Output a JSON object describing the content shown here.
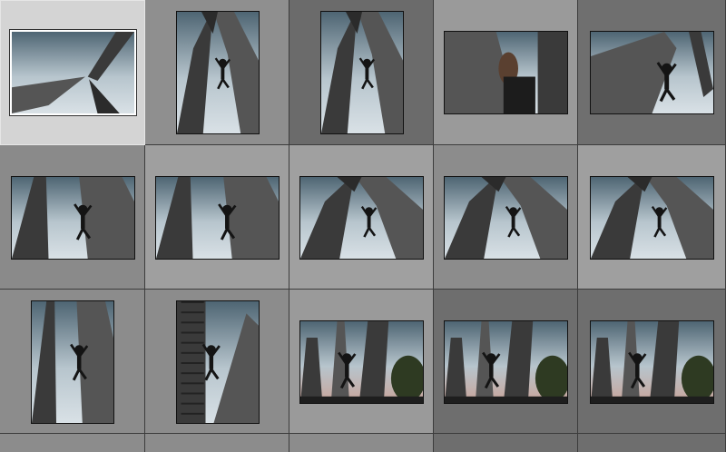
{
  "app": {
    "view": "grid",
    "accent_selected": "#d6d6d6",
    "cell_light": "#a3a3a3",
    "cell_mid": "#8c8c8c",
    "cell_dark": "#6b6b6b"
  },
  "thumbnails": [
    {
      "name": "monument-arms-up",
      "icon": "photo-icon",
      "orient": "landscape",
      "scene": "upward-arms",
      "selected": true
    },
    {
      "name": "climber-between-pillars",
      "icon": "photo-icon",
      "orient": "portrait",
      "scene": "arch-climber"
    },
    {
      "name": "climber-arch-high",
      "icon": "photo-icon",
      "orient": "portrait",
      "scene": "arch-climber"
    },
    {
      "name": "climber-closeup-wall",
      "icon": "photo-icon",
      "orient": "landscape",
      "scene": "closeup"
    },
    {
      "name": "climber-crouch-side",
      "icon": "photo-icon",
      "orient": "landscape",
      "scene": "side-climber"
    },
    {
      "name": "climber-left-column",
      "icon": "photo-icon",
      "orient": "landscape",
      "scene": "wall-climber"
    },
    {
      "name": "climber-mid-column",
      "icon": "photo-icon",
      "orient": "landscape",
      "scene": "wall-climber"
    },
    {
      "name": "climber-under-arch-a",
      "icon": "photo-icon",
      "orient": "landscape",
      "scene": "arch-climber"
    },
    {
      "name": "climber-under-arch-b",
      "icon": "photo-icon",
      "orient": "landscape",
      "scene": "arch-climber"
    },
    {
      "name": "climber-under-arch-c",
      "icon": "photo-icon",
      "orient": "landscape",
      "scene": "arch-climber"
    },
    {
      "name": "climber-tall-slab",
      "icon": "photo-icon",
      "orient": "portrait",
      "scene": "wall-climber"
    },
    {
      "name": "climber-stepped-tower",
      "icon": "photo-icon",
      "orient": "portrait",
      "scene": "tower"
    },
    {
      "name": "pillars-dusk-a",
      "icon": "photo-icon",
      "orient": "landscape",
      "scene": "pillars-dusk"
    },
    {
      "name": "pillars-dusk-b",
      "icon": "photo-icon",
      "orient": "landscape",
      "scene": "pillars-dusk"
    },
    {
      "name": "pillars-dusk-c",
      "icon": "photo-icon",
      "orient": "landscape",
      "scene": "pillars-dusk"
    }
  ]
}
